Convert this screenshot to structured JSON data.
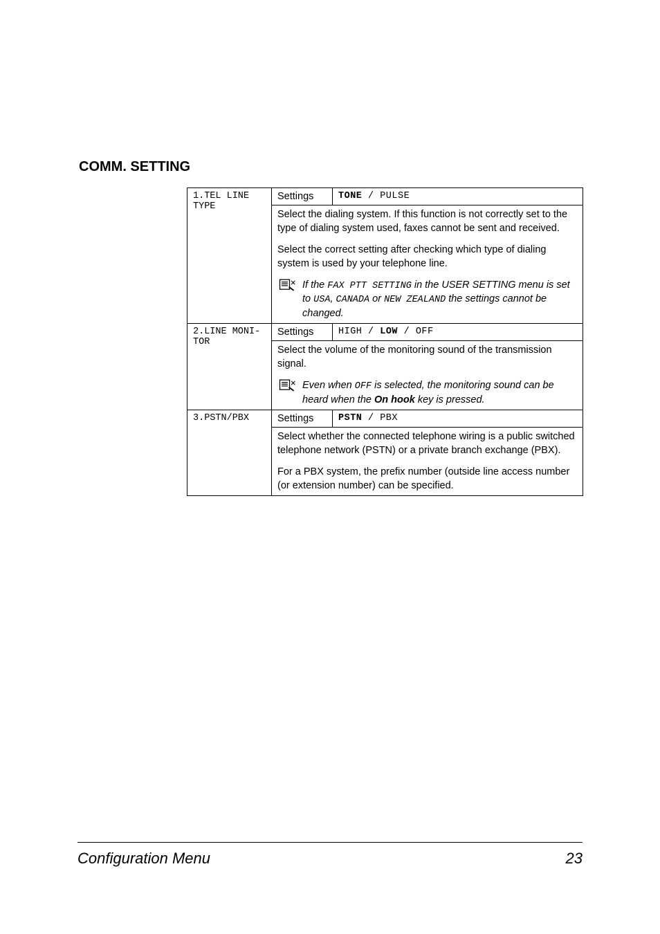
{
  "heading": "COMM. SETTING",
  "rows": [
    {
      "name": "1.TEL LINE TYPE",
      "settings_label": "Settings",
      "settings_value_html": "<span class='bold'>TONE</span> / PULSE",
      "description": [
        "Select the dialing system. If this function is not correctly set to the type of dialing system used, faxes cannot be sent and received.",
        "Select the correct setting after checking which type of dialing system is used by your telephone line."
      ],
      "note_html": "If the <span class='mono'>FAX PTT SETTING</span> in the USER SETTING menu is set to <span class='mono'>USA</span>, <span class='mono'>CANADA</span> or <span class='mono'>NEW ZEALAND</span> the settings cannot be changed."
    },
    {
      "name": "2.LINE MONI-TOR",
      "settings_label": "Settings",
      "settings_value_html": "HIGH / <span class='bold'>LOW</span> / OFF",
      "description": [
        "Select the volume of the monitoring sound of the transmission signal."
      ],
      "note_html": "Even when <span class='mono'>OFF</span> is selected, the monitoring sound can be heard when the <span class='bold'>On hook</span> key is pressed."
    },
    {
      "name": "3.PSTN/PBX",
      "settings_label": "Settings",
      "settings_value_html": "<span class='bold'>PSTN</span> / PBX",
      "description": [
        "Select whether the connected telephone wiring is a public switched telephone network (PSTN) or a private branch exchange (PBX).",
        "For a PBX system, the prefix number (outside line access number (or extension number) can be specified."
      ]
    }
  ],
  "footer": {
    "title": "Configuration Menu",
    "page": "23"
  }
}
